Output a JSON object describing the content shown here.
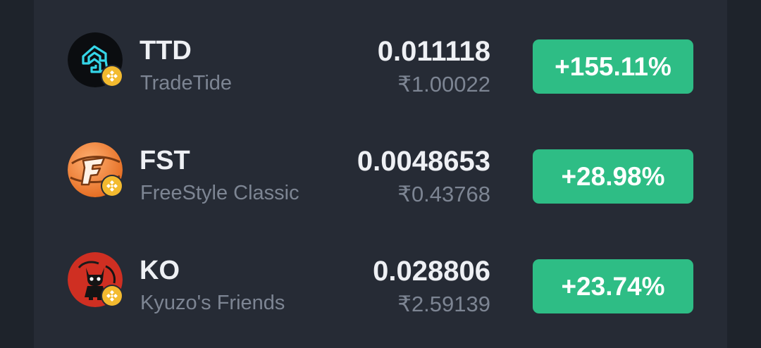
{
  "colors": {
    "background": "#1e232b",
    "panel": "#262b35",
    "primary_text": "#eef0f4",
    "secondary_text": "#7d8593",
    "positive": "#2ebd85",
    "chain_badge": "#f3ba2f"
  },
  "tokens": [
    {
      "symbol": "TTD",
      "name": "TradeTide",
      "price": "0.011118",
      "fiat_price": "₹1.00022",
      "change": "+155.11%",
      "logo_icon": "tradetide-logo-icon",
      "chain_icon": "bnb-chain-icon"
    },
    {
      "symbol": "FST",
      "name": "FreeStyle Classic",
      "price": "0.0048653",
      "fiat_price": "₹0.43768",
      "change": "+28.98%",
      "logo_icon": "freestyle-logo-icon",
      "chain_icon": "bnb-chain-icon"
    },
    {
      "symbol": "KO",
      "name": "Kyuzo's Friends",
      "price": "0.028806",
      "fiat_price": "₹2.59139",
      "change": "+23.74%",
      "logo_icon": "kyuzo-logo-icon",
      "chain_icon": "bnb-chain-icon"
    }
  ]
}
